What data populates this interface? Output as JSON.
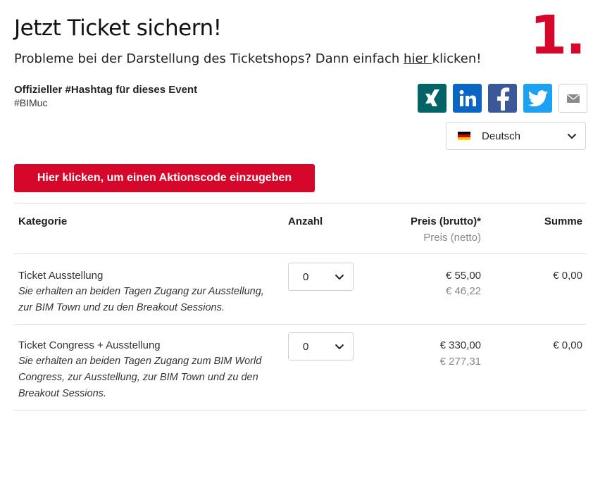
{
  "header": {
    "title": "Jetzt Ticket sichern!",
    "step": "1.",
    "notice_before": "Probleme bei der Darstellung des Ticketshops? Dann einfach ",
    "notice_link": "hier ",
    "notice_after": "klicken!"
  },
  "hashtag": {
    "title": "Offizieller #Hashtag für dieses Event",
    "value": "#BIMuc"
  },
  "share": {
    "colors": {
      "xing": "#026466",
      "linkedin": "#0a66c2",
      "facebook": "#3b5998",
      "twitter": "#1da1f2"
    },
    "icons": [
      "xing-icon",
      "linkedin-icon",
      "facebook-icon",
      "twitter-icon",
      "mail-icon"
    ]
  },
  "language": {
    "selected": "Deutsch"
  },
  "promo_button": "Hier klicken, um einen Aktionscode einzugeben",
  "table": {
    "headers": {
      "category": "Kategorie",
      "quantity": "Anzahl",
      "price_gross": "Preis (brutto)*",
      "price_net": "Preis (netto)",
      "sum": "Summe"
    },
    "rows": [
      {
        "name": "Ticket Ausstellung",
        "desc_lines": [
          "Sie erhalten an beiden Tagen Zugang zur Ausstellung,",
          "zur BIM Town und zu den Breakout Sessions."
        ],
        "quantity": "0",
        "price_gross": "€ 55,00",
        "price_net": "€ 46,22",
        "sum": "€ 0,00"
      },
      {
        "name": "Ticket Congress + Ausstellung",
        "desc_lines": [
          "Sie erhalten an beiden Tagen Zugang zum BIM World",
          "Congress, zur Ausstellung, zur BIM Town und zu den",
          "Breakout Sessions."
        ],
        "quantity": "0",
        "price_gross": "€ 330,00",
        "price_net": "€ 277,31",
        "sum": "€ 0,00"
      }
    ]
  },
  "accent_color": "#d7072b"
}
